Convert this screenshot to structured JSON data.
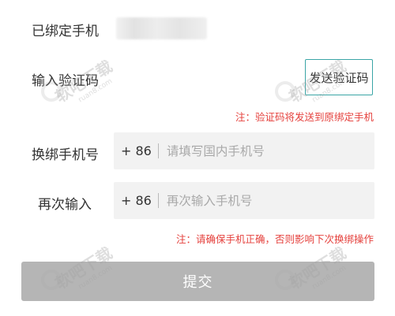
{
  "bound_phone": {
    "label": "已绑定手机"
  },
  "verify_code": {
    "label": "输入验证码",
    "send_button": "发送验证码"
  },
  "notice_code": "注：验证码将发送到原绑定手机",
  "new_phone": {
    "label": "换绑手机号",
    "prefix": "+ 86",
    "placeholder": "请填写国内手机号",
    "value": ""
  },
  "confirm_phone": {
    "label": "再次输入",
    "prefix": "+ 86",
    "placeholder": "再次输入手机号",
    "value": ""
  },
  "notice_confirm": "注：请确保手机正确，否则影响下次换绑操作",
  "submit_button": "提交",
  "watermark": {
    "brand": "软吧下载",
    "domain": "ruan8.com"
  },
  "colors": {
    "accent_border": "#3aa5a6",
    "notice": "#e5413d",
    "submit_bg": "#b5b5b5",
    "input_bg": "#f2f2f2"
  }
}
